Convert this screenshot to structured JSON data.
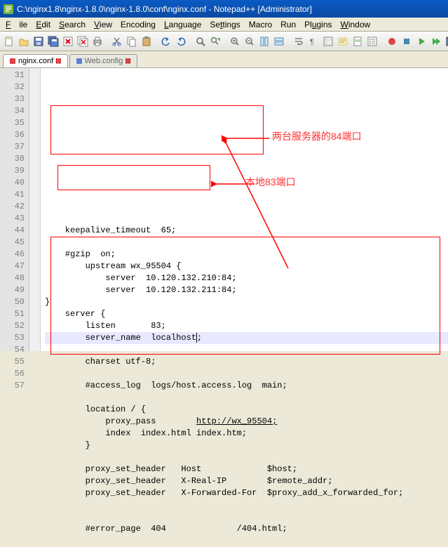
{
  "title": "C:\\nginx1.8\\nginx-1.8.0\\nginx-1.8.0\\conf\\nginx.conf - Notepad++ [Administrator]",
  "menu": {
    "file": "File",
    "edit": "Edit",
    "search": "Search",
    "view": "View",
    "encoding": "Encoding",
    "language": "Language",
    "settings": "Settings",
    "macro": "Macro",
    "run": "Run",
    "plugins": "Plugins",
    "window": "Window"
  },
  "tabs": {
    "t1": "nginx.conf",
    "t2": "Web.config"
  },
  "lineStart": 31,
  "lines": [
    "    keepalive_timeout  65;",
    "",
    "    #gzip  on;",
    "        upstream wx_95504 {",
    "            server  10.120.132.210:84;",
    "            server  10.120.132.211:84;",
    "}",
    "    server {",
    "        listen       83;",
    "        server_name  localhost;",
    "",
    "        charset utf-8;",
    "",
    "        #access_log  logs/host.access.log  main;",
    "",
    "        location / {",
    "            proxy_pass        http://wx_95504;",
    "            index  index.html index.htm;",
    "        }",
    "",
    "        proxy_set_header   Host             $host;",
    "        proxy_set_header   X-Real-IP        $remote_addr;",
    "        proxy_set_header   X-Forwarded-For  $proxy_add_x_forwarded_for;",
    "",
    "",
    "        #error_page  404              /404.html;",
    ""
  ],
  "highlightLine": 40,
  "underlinePart": "http://wx_95504;",
  "annot": {
    "a1": "两台服务器的84端口",
    "a2": "本地83端口"
  }
}
